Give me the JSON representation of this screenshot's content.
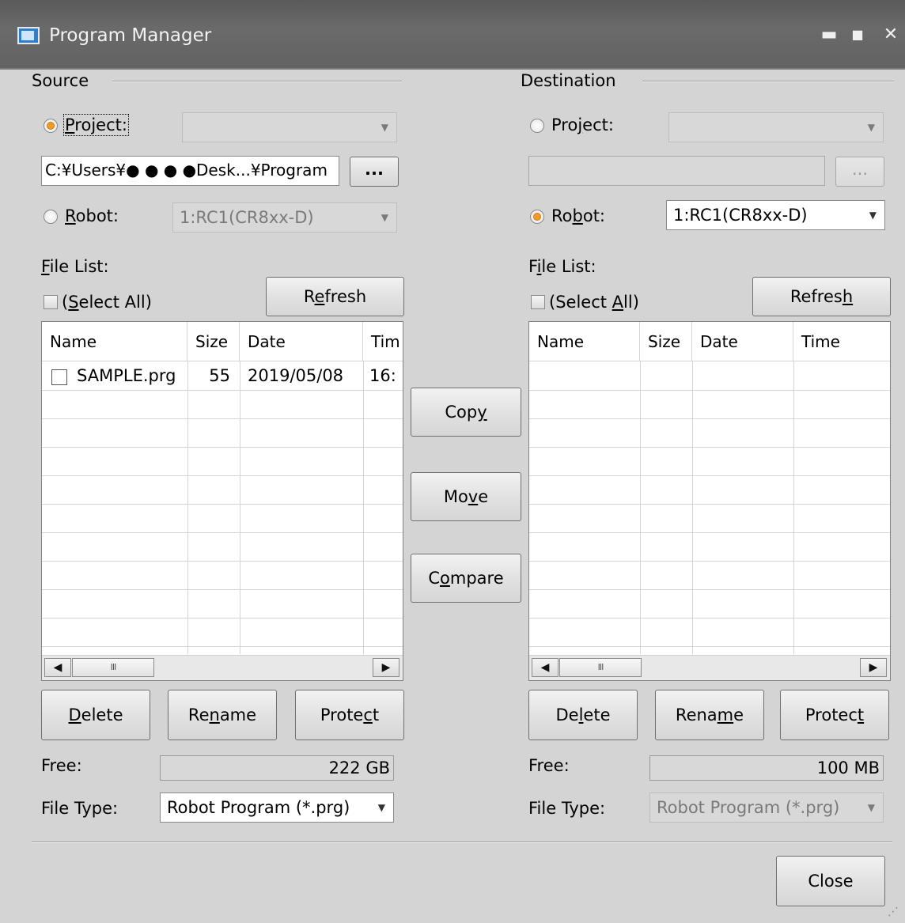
{
  "window": {
    "title": "Program Manager",
    "minimize_glyph": "▬",
    "maximize_glyph": "■",
    "close_glyph": "✕"
  },
  "source": {
    "group_label": "Source",
    "project_label": "Project:",
    "project_selected": true,
    "project_combo_value": "",
    "path_value": "C:¥Users¥● ● ● ●Desk...¥Program",
    "browse_label": "...",
    "robot_label": "Robot:",
    "robot_combo_value": "1:RC1(CR8xx-D)",
    "file_list_label": "File List:",
    "select_all_label": "(Select All)",
    "refresh_label": "Refresh",
    "columns": [
      "Name",
      "Size",
      "Date",
      "Tim"
    ],
    "rows": [
      {
        "name": "SAMPLE.prg",
        "size": "55",
        "date": "2019/05/08",
        "time": "16:"
      }
    ],
    "scroll_thumb_glyph": "III",
    "delete_label": "Delete",
    "rename_label": "Rename",
    "protect_label": "Protect",
    "free_label": "Free:",
    "free_value": "222 GB",
    "file_type_label": "File Type:",
    "file_type_value": "Robot Program (*.prg)"
  },
  "actions": {
    "copy_label": "Copy",
    "move_label": "Move",
    "compare_label": "Compare"
  },
  "destination": {
    "group_label": "Destination",
    "project_label": "Project:",
    "project_combo_value": "",
    "path_value": "",
    "browse_label": "...",
    "robot_label": "Robot:",
    "robot_selected": true,
    "robot_combo_value": "1:RC1(CR8xx-D)",
    "file_list_label": "File List:",
    "select_all_label": "(Select All)",
    "refresh_label": "Refresh",
    "columns": [
      "Name",
      "Size",
      "Date",
      "Time"
    ],
    "rows": [],
    "scroll_thumb_glyph": "III",
    "delete_label": "Delete",
    "rename_label": "Rename",
    "protect_label": "Protect",
    "free_label": "Free:",
    "free_value": "100 MB",
    "file_type_label": "File Type:",
    "file_type_value": "Robot Program (*.prg)"
  },
  "footer": {
    "close_label": "Close"
  },
  "colors": {
    "titlebar": "#626262",
    "dialog_bg": "#d4d4d4",
    "radio_selected": "#f09a2a"
  }
}
